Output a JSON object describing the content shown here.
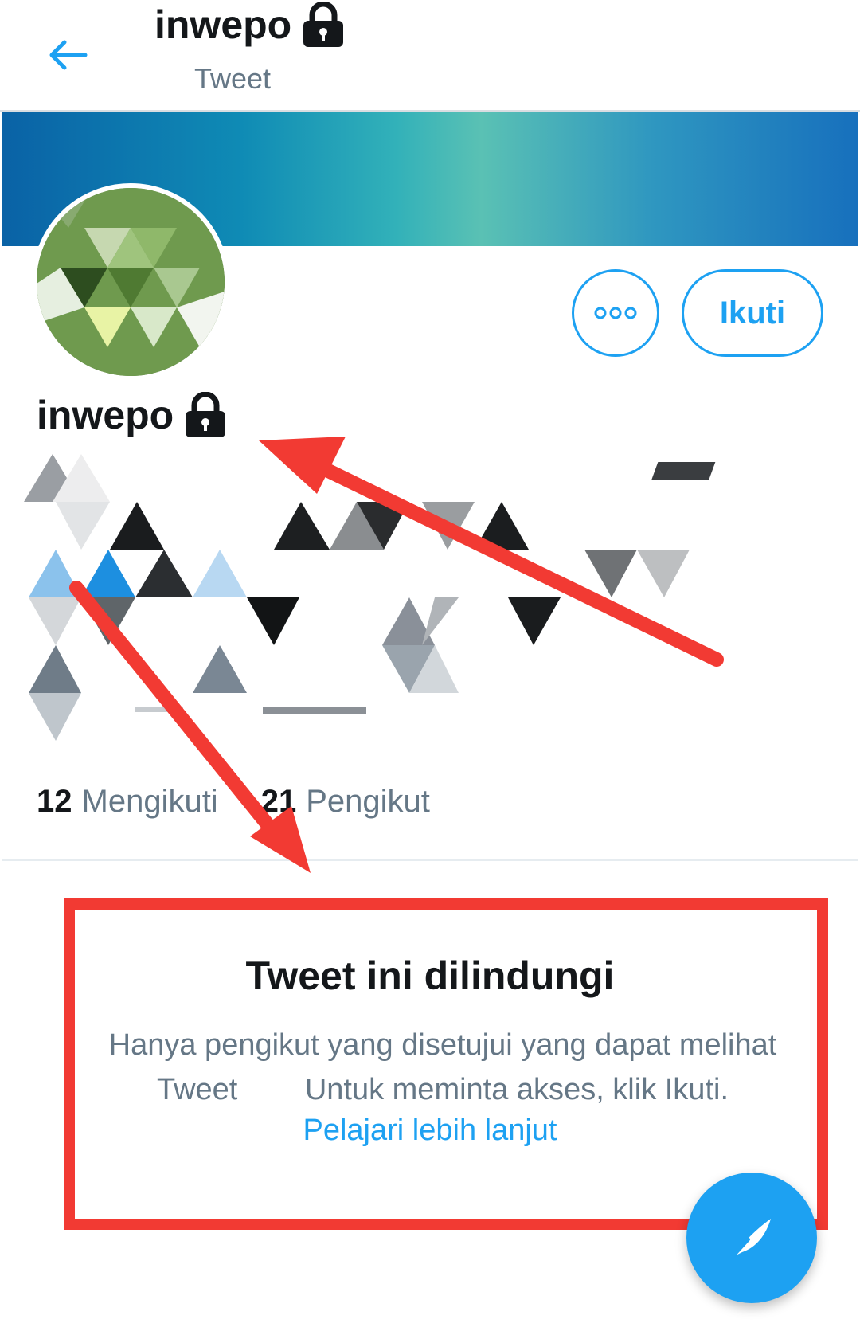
{
  "header": {
    "title": "inwepo",
    "subtitle": "Tweet",
    "back_icon": "arrow-left-icon",
    "lock_icon": "lock-icon"
  },
  "profile": {
    "name": "inwepo",
    "lock_icon": "lock-icon",
    "more_icon": "more-dots-icon",
    "follow_label": "Ikuti"
  },
  "stats": {
    "following_count": "12",
    "following_label": "Mengikuti",
    "followers_count": "21",
    "followers_label": "Pengikut"
  },
  "protected": {
    "title": "Tweet ini dilindungi",
    "line1": "Hanya pengikut yang disetujui yang dapat melihat",
    "line2": "Tweet        Untuk meminta akses, klik Ikuti.",
    "link": "Pelajari lebih lanjut"
  },
  "fab": {
    "icon": "compose-tweet-icon"
  },
  "colors": {
    "accent": "#1da1f2",
    "annotation_red": "#f23a33",
    "secondary_text": "#657786",
    "primary_text": "#14171a"
  }
}
